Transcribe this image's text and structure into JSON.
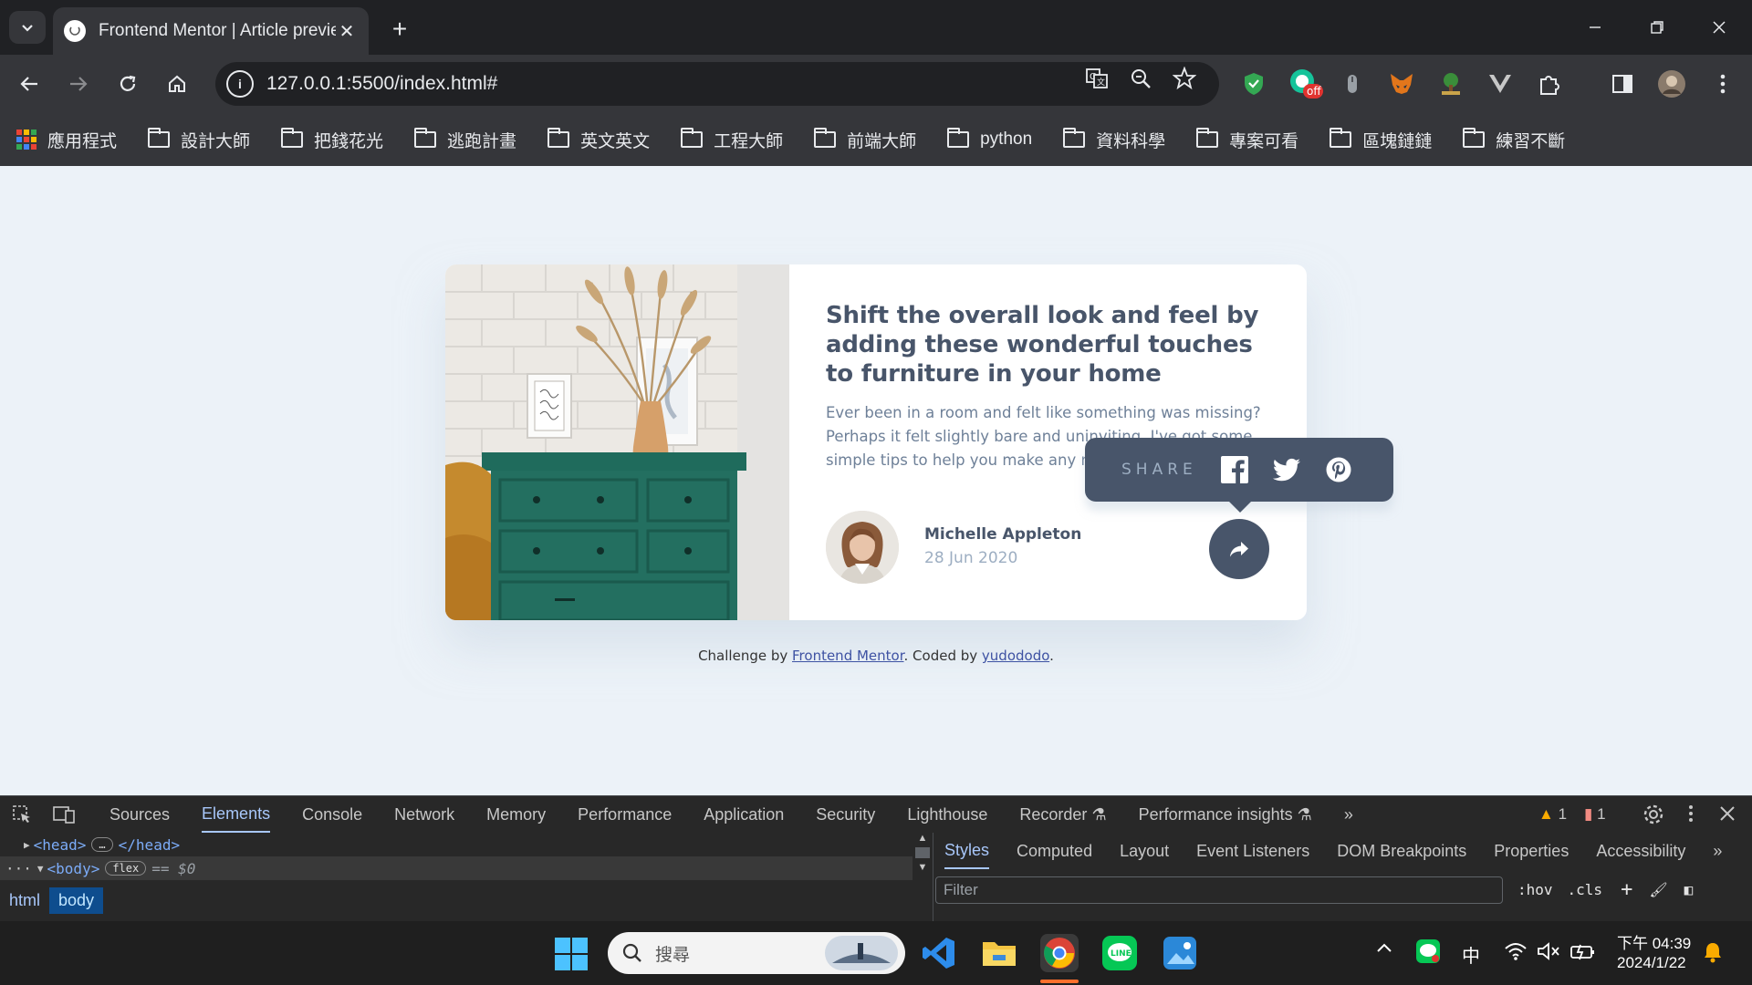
{
  "browser": {
    "tab_title": "Frontend Mentor | Article preview component",
    "new_tab": "+",
    "url": "127.0.0.1:5500/index.html#",
    "bookmarks": [
      {
        "label": "應用程式",
        "type": "apps"
      },
      {
        "label": "設計大師",
        "type": "folder"
      },
      {
        "label": "把錢花光",
        "type": "folder"
      },
      {
        "label": "逃跑計畫",
        "type": "folder"
      },
      {
        "label": "英文英文",
        "type": "folder"
      },
      {
        "label": "工程大師",
        "type": "folder"
      },
      {
        "label": "前端大師",
        "type": "folder"
      },
      {
        "label": "python",
        "type": "folder"
      },
      {
        "label": "資料科學",
        "type": "folder"
      },
      {
        "label": "專案可看",
        "type": "folder"
      },
      {
        "label": "區塊鏈鏈",
        "type": "folder"
      },
      {
        "label": "練習不斷",
        "type": "folder"
      }
    ],
    "extension_badge": "off"
  },
  "article": {
    "title": "Shift the overall look and feel by adding these wonderful touches to furniture in your home",
    "description": "Ever been in a room and felt like something was missing? Perhaps it felt slightly bare and uninviting. I've got some simple tips to help you make any room feel complete.",
    "author_name": "Michelle Appleton",
    "date": "28 Jun 2020"
  },
  "share": {
    "label": "SHARE",
    "networks": [
      "facebook",
      "twitter",
      "pinterest"
    ]
  },
  "attribution": {
    "prefix": "Challenge by ",
    "link1": "Frontend Mentor",
    "middle": ". Coded by ",
    "link2": "yudododo",
    "suffix": "."
  },
  "devtools": {
    "tabs": [
      "Sources",
      "Elements",
      "Console",
      "Network",
      "Memory",
      "Performance",
      "Application",
      "Security",
      "Lighthouse",
      "Recorder",
      "Performance insights"
    ],
    "active_tab": "Elements",
    "warnings": "1",
    "issues": "1",
    "tree": {
      "head_open": "<head>",
      "head_close": "</head>",
      "body_open": "<body>",
      "body_badge": "flex",
      "body_ref": "== $0"
    },
    "breadcrumbs": [
      "html",
      "body"
    ],
    "styles_tabs": [
      "Styles",
      "Computed",
      "Layout",
      "Event Listeners",
      "DOM Breakpoints",
      "Properties",
      "Accessibility"
    ],
    "filter_placeholder": "Filter",
    "hov": ":hov",
    "cls": ".cls"
  },
  "taskbar": {
    "search_placeholder": "搜尋",
    "ime": "中",
    "time": "下午 04:39",
    "date": "2024/1/22"
  },
  "colors": {
    "accent_dark": "#48556a",
    "text_muted": "#6e8098",
    "text_light": "#9daec2",
    "page_bg": "#ecf2f8"
  }
}
